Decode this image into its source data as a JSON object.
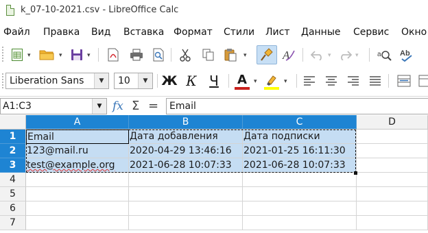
{
  "window": {
    "title": "k_07-10-2021.csv - LibreOffice Calc"
  },
  "menu": [
    "Файл",
    "Правка",
    "Вид",
    "Вставка",
    "Формат",
    "Стили",
    "Лист",
    "Данные",
    "Сервис",
    "Окно"
  ],
  "toolbar1": {
    "icons": [
      "new-spreadsheet-icon",
      "open-folder-icon",
      "save-icon",
      "export-pdf-icon",
      "print-icon",
      "print-preview-icon",
      "cut-icon",
      "copy-icon",
      "paste-icon",
      "clone-formatting-icon",
      "clear-formatting-icon",
      "undo-icon",
      "redo-icon",
      "find-replace-icon",
      "spelling-icon"
    ]
  },
  "toolbar2": {
    "font_name": "Liberation Sans",
    "font_size": "10",
    "bold_label": "Ж",
    "italic_label": "К",
    "underline_label": "Ч",
    "font_color_label": "A",
    "font_color": "#c9211e",
    "highlight_color": "#ffff00"
  },
  "formula_bar": {
    "name_box": "A1:C3",
    "fx_label": "fx",
    "sum_label": "Σ",
    "equals_label": "=",
    "content": "Email"
  },
  "sheet": {
    "columns": [
      "A",
      "B",
      "C",
      "D"
    ],
    "row_numbers": [
      "1",
      "2",
      "3",
      "4",
      "5",
      "6",
      "7"
    ],
    "rows": [
      [
        "Email",
        "Дата добавления",
        "Дата подписки",
        ""
      ],
      [
        "123@mail.ru",
        "2020-04-29 13:46:16",
        "2021-01-25 16:11:30",
        ""
      ],
      [
        "test@example.org",
        "2021-06-28 10:07:33",
        "2021-06-28 10:07:33",
        ""
      ]
    ]
  },
  "colors": {
    "selection_header": "#1e84d3",
    "selection_fill": "#c5ddf3"
  }
}
